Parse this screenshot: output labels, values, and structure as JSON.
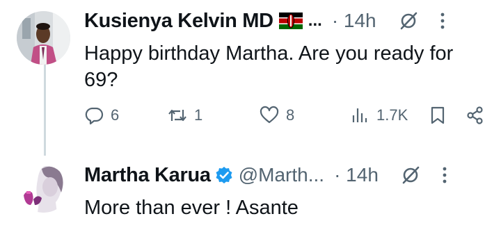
{
  "tweets": [
    {
      "display_name": "Kusienya Kelvin MD",
      "flag_icon": "kenya-flag-icon",
      "name_ellipsis": "...",
      "time": "· 14h",
      "text": "Happy birthday Martha. Are you ready for 69?",
      "actions": {
        "replies": "6",
        "reposts": "1",
        "likes": "8",
        "views": "1.7K"
      }
    },
    {
      "display_name": "Martha Karua",
      "verified": true,
      "handle": "@Marth...",
      "time": "· 14h",
      "text": "More than ever ! Asante"
    }
  ],
  "icons": {
    "reply": "reply-icon",
    "repost": "repost-icon",
    "like": "heart-icon",
    "views": "views-icon",
    "bookmark": "bookmark-icon",
    "share": "share-icon",
    "grok": "grok-icon",
    "more": "more-icon"
  },
  "colors": {
    "text": "#0f1419",
    "secondary": "#536471",
    "verified": "#1d9bf0",
    "thread_line": "#cfd9de"
  }
}
